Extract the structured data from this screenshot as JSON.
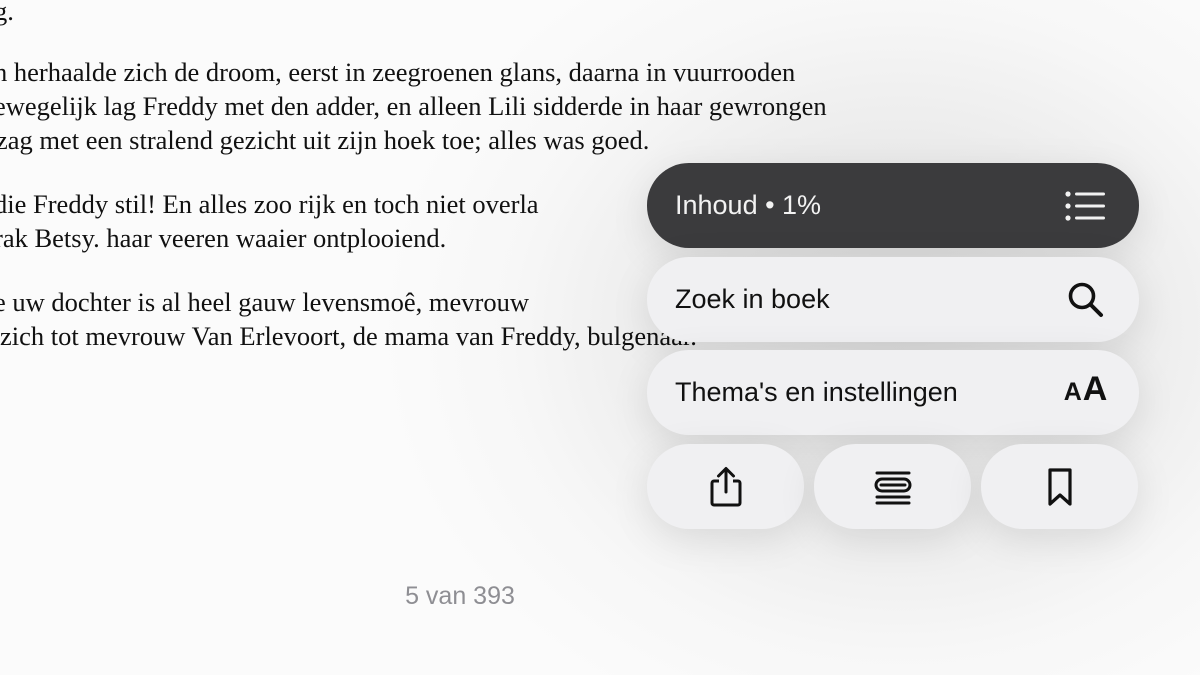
{
  "book": {
    "lines": [
      "g.",
      "n herhaalde zich de droom, eerst in zeegroenen glans, daarna in vuurrooden",
      "ewegelijk lag Freddy met den adder, en alleen Lili sidderde in haar gewrongen",
      "zag met een stralend gezicht uit zijn hoek toe; alles was goed.",
      "die Freddy stil! En alles zoo rijk en toch niet overla",
      "rak Betsy. haar veeren waaier ontplooiend.",
      "e uw dochter is al heel gauw levensmoê, mevrouw",
      "zich tot mevrouw Van Erlevoort, de mama van Freddy,  bulgenaar."
    ],
    "page_indicator": "5 van 393"
  },
  "menu": {
    "contents": {
      "label": "Inhoud • 1%",
      "icon": "list-icon"
    },
    "search": {
      "label": "Zoek in boek",
      "icon": "search-icon"
    },
    "themes": {
      "label": "Thema's en instellingen",
      "icon": "text-size-icon",
      "icon_small": "A",
      "icon_big": "A"
    },
    "buttons": [
      {
        "name": "share",
        "icon": "share-icon"
      },
      {
        "name": "scroll",
        "icon": "scroll-view-icon"
      },
      {
        "name": "bookmark",
        "icon": "bookmark-icon"
      }
    ]
  },
  "colors": {
    "dark_row": "#3b3b3d",
    "light_row": "#f0f0f2",
    "page_indicator": "#8e8e93"
  }
}
